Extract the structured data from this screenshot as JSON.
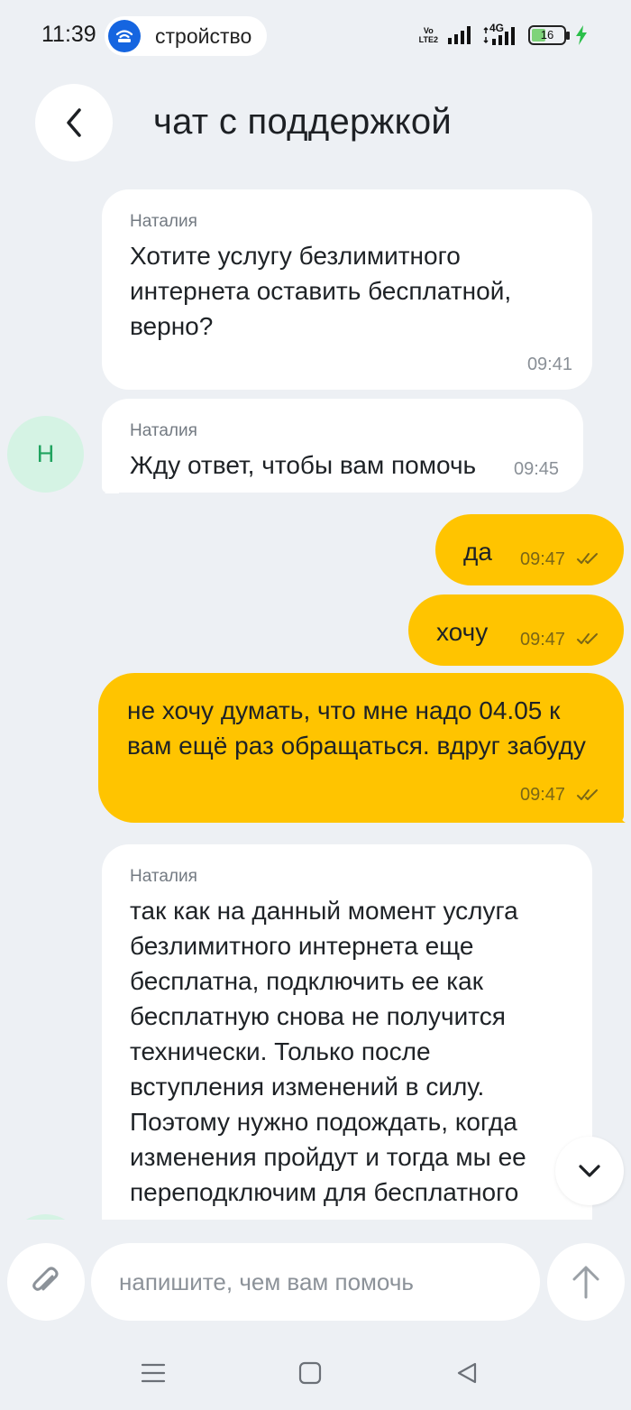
{
  "status_bar": {
    "time": "11:39",
    "notification_text": "стройство",
    "volte_label_top": "Vo",
    "volte_label_bottom": "LTE2",
    "network_label": "4G",
    "battery_level": "16"
  },
  "header": {
    "title": "чат с поддержкой"
  },
  "messages": [
    {
      "sender": "Наталия",
      "lines": [
        "Хотите услугу безлимитного",
        "интернета оставить бесплатной,",
        "верно?"
      ],
      "time": "09:41"
    },
    {
      "sender": "Наталия",
      "lines": [
        "Жду ответ, чтобы вам помочь"
      ],
      "time": "09:45",
      "avatar": "Н"
    },
    {
      "lines": [
        "да"
      ],
      "time": "09:47"
    },
    {
      "lines": [
        "хочу"
      ],
      "time": "09:47"
    },
    {
      "lines": [
        "не хочу думать, что мне надо 04.05 к",
        "вам ещё раз обращаться. вдруг забуду"
      ],
      "time": "09:47"
    },
    {
      "sender": "Наталия",
      "lines": [
        "так как на данный момент услуга",
        "безлимитного интернета еще",
        "бесплатна, подключить ее как",
        "бесплатную снова не получится",
        "технически. Только после",
        "вступления изменений в силу.",
        "Поэтому нужно подождать, когда",
        "изменения пройдут и тогда мы ее",
        "переподключим для бесплатного"
      ]
    }
  ],
  "composer": {
    "placeholder": "напишите, чем вам помочь"
  },
  "colors": {
    "background": "#edf0f4",
    "incoming_bubble": "#ffffff",
    "outgoing_bubble": "#ffc400",
    "avatar_bg": "#d5f3e4",
    "avatar_text": "#20a35f"
  }
}
